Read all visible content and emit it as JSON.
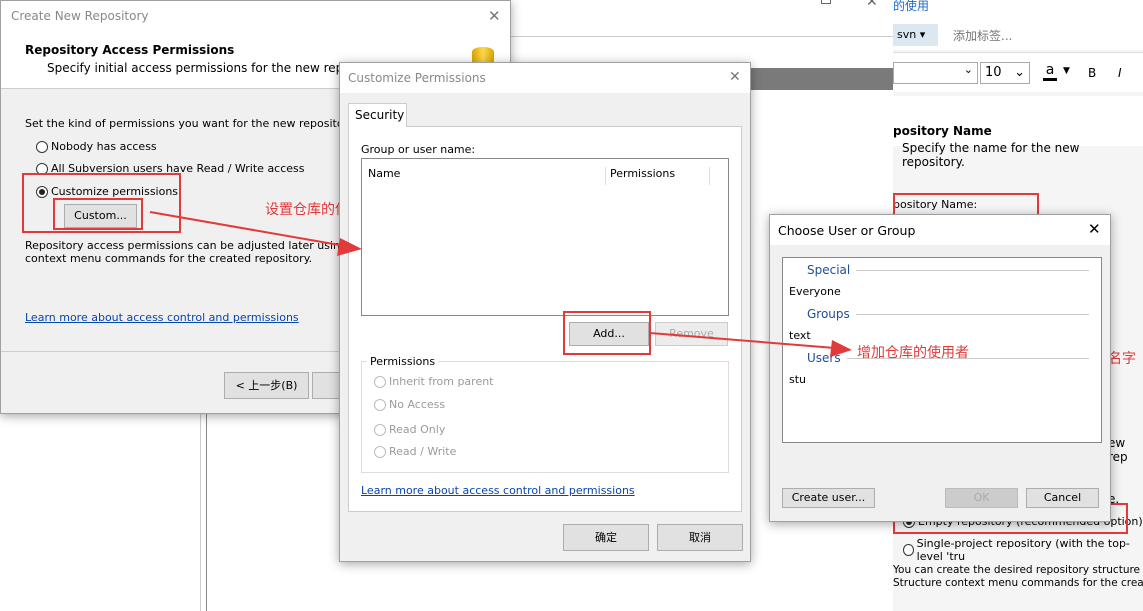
{
  "background": {
    "link_fragment": "的使用",
    "tag_button": "svn ▾",
    "add_tag": "添加标签...",
    "font_size": "10",
    "font_color": "a",
    "bold": "B",
    "italic": "I",
    "heading": "pository Name",
    "subheading": "Specify the name for the new repository.",
    "field_label": "pository Name:",
    "fragment_rep": "ew rep",
    "fragment_e": "e.",
    "option_empty": "Empty repository (recommended option)",
    "option_single": "Single-project repository (with the top-level 'tru",
    "footer_line1": "You can create the desired repository structure later",
    "footer_line2": "Structure context menu commands for the created r"
  },
  "create_repo": {
    "title": "Create New Repository",
    "heading": "Repository Access Permissions",
    "subheading": "Specify initial access permissions for the new repository.",
    "prompt": "Set the kind of permissions you want for the new repository.",
    "options": [
      {
        "label": "Nobody has access",
        "selected": false
      },
      {
        "label": "All Subversion users have Read / Write access",
        "selected": false
      },
      {
        "label": "Customize permissions",
        "selected": true
      }
    ],
    "custom_button": "Custom...",
    "info_line1": "Repository access permissions can be adjusted later using the ...",
    "info_line2": "context menu commands for the created repository.",
    "learn_more": "Learn more about access control and permissions",
    "back_button": "< 上一步(B)"
  },
  "customize": {
    "title": "Customize Permissions",
    "tab": "Security",
    "group_label": "Group or user name:",
    "columns": [
      "Name",
      "Permissions"
    ],
    "add_button": "Add...",
    "remove_button": "Remove",
    "permissions_label": "Permissions",
    "permission_options": [
      "Inherit from parent",
      "No Access",
      "Read Only",
      "Read / Write"
    ],
    "learn_more": "Learn more about access control and permissions",
    "ok_button": "确定",
    "cancel_button": "取消"
  },
  "choose": {
    "title": "Choose User or Group",
    "sections": [
      {
        "header": "Special",
        "items": [
          "Everyone"
        ]
      },
      {
        "header": "Groups",
        "items": [
          "text"
        ]
      },
      {
        "header": "Users",
        "items": [
          "stu"
        ]
      }
    ],
    "create_user_button": "Create user...",
    "ok_button": "OK",
    "cancel_button": "Cancel"
  },
  "annotations": {
    "set_users": "设置仓库的使用者",
    "add_users": "增加仓库的使用者",
    "name_fragment": "名字"
  },
  "colors": {
    "annotation": "#e23a3a",
    "link": "#0645ad",
    "section": "#1e4e9a"
  }
}
